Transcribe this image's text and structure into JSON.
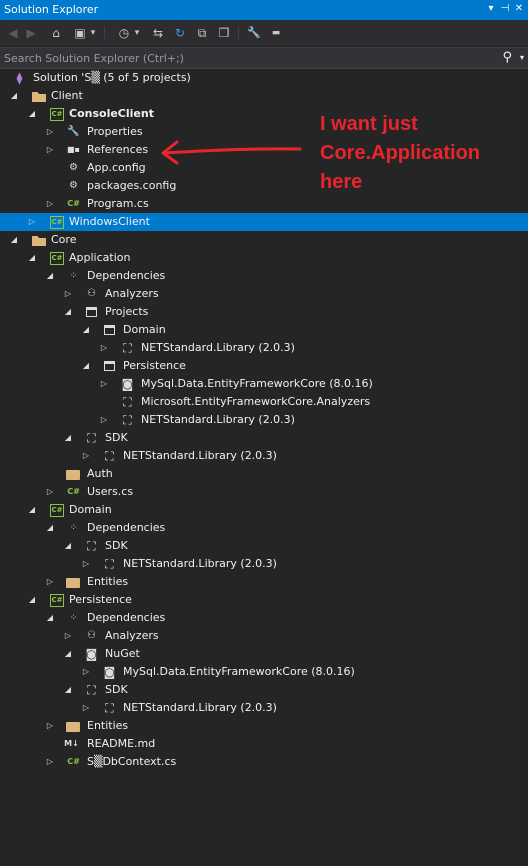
{
  "window": {
    "title": "Solution Explorer",
    "pin_glyph": "▾",
    "pin2_glyph": "⊣",
    "close_glyph": "✕"
  },
  "toolbar": {
    "icons": [
      "back-icon",
      "forward-icon",
      "home-icon",
      "switch-views-icon",
      "pending-changes-filter-icon",
      "sync-icon",
      "refresh-icon",
      "collapse-all-icon",
      "show-all-files-icon",
      "properties-icon",
      "preview-icon"
    ],
    "glyphs": {
      "back": "◀",
      "forward": "▶",
      "home": "⌂",
      "switch": "▣",
      "dd": "▾",
      "history": "◷",
      "sync": "⇆",
      "refresh": "↻",
      "collapse": "⧉",
      "showall": "❐",
      "wrench": "🔧",
      "dash": "▬"
    }
  },
  "search": {
    "placeholder": "Search Solution Explorer (Ctrl+;)",
    "icon": "⚲",
    "dropdown": "▾"
  },
  "tree": {
    "solution": "Solution 'S▒ (5 of 5 projects)",
    "client": "Client",
    "consoleclient": "ConsoleClient",
    "cc_properties": "Properties",
    "cc_references": "References",
    "cc_appconfig": "App.config",
    "cc_packages": "packages.config",
    "cc_program": "Program.cs",
    "windowsclient": "WindowsClient",
    "core": "Core",
    "application": "Application",
    "app_dependencies": "Dependencies",
    "app_analyzers": "Analyzers",
    "app_projects": "Projects",
    "app_proj_domain": "Domain",
    "app_proj_domain_netstd": "NETStandard.Library (2.0.3)",
    "app_proj_persistence": "Persistence",
    "app_proj_pers_mysql": "MySql.Data.EntityFrameworkCore (8.0.16)",
    "app_proj_pers_analyzers": "Microsoft.EntityFrameworkCore.Analyzers",
    "app_proj_pers_netstd": "NETStandard.Library (2.0.3)",
    "app_sdk": "SDK",
    "app_sdk_netstd": "NETStandard.Library (2.0.3)",
    "app_auth": "Auth",
    "app_users": "Users.cs",
    "domain": "Domain",
    "dom_dependencies": "Dependencies",
    "dom_sdk": "SDK",
    "dom_sdk_netstd": "NETStandard.Library (2.0.3)",
    "dom_entities": "Entities",
    "persistence": "Persistence",
    "per_dependencies": "Dependencies",
    "per_analyzers": "Analyzers",
    "per_nuget": "NuGet",
    "per_nuget_mysql": "MySql.Data.EntityFrameworkCore (8.0.16)",
    "per_sdk": "SDK",
    "per_sdk_netstd": "NETStandard.Library (2.0.3)",
    "per_entities": "Entities",
    "readme": "README.md",
    "dbcontext": "S▒DbContext.cs"
  },
  "annotation": {
    "line1": "I want just",
    "line2": "Core.Application",
    "line3": "here"
  },
  "colors": {
    "accent": "#007acc",
    "background": "#252526",
    "annotation": "#e8252d",
    "csharp": "#8bc34a",
    "folder": "#dcb67a"
  }
}
